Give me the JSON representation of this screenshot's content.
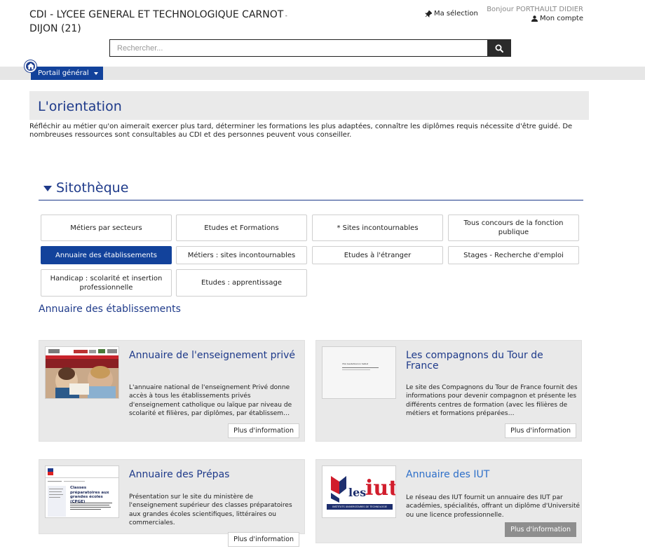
{
  "header": {
    "title_line1": "CDI - LYCEE GENERAL ET TECHNOLOGIQUE CARNOT",
    "title_sep": " -",
    "title_line2": "DIJON (21)",
    "selection_label": "Ma sélection",
    "greeting": "Bonjour PORTHAULT DIDIER",
    "account_label": "Mon compte"
  },
  "search": {
    "placeholder": "Rechercher..."
  },
  "nav": {
    "portal_label": "Portail général"
  },
  "page": {
    "title": "L'orientation",
    "intro": "Réfléchir au métier qu'on aimerait exercer plus tard, déterminer les formations les plus adaptées, connaître les diplômes requis nécessite d'être guidé. De nombreuses ressources sont consultables au CDI et des personnes peuvent vous conseiller."
  },
  "sitotheque": {
    "heading": "Sitothèque",
    "tiles": [
      "Métiers par secteurs",
      "Etudes et Formations",
      "* Sites incontournables",
      "Tous concours de la fonction publique",
      "Annuaire des établissements",
      "Métiers : sites incontournables",
      "Etudes à l'étranger",
      "Stages - Recherche d'emploi",
      "Handicap : scolarité et insertion professionnelle",
      "Etudes : apprentissage"
    ],
    "active_index": 4,
    "section_title": "Annuaire des établissements"
  },
  "cards": [
    {
      "title": "Annuaire de l'enseignement privé",
      "desc": "L'annuaire national de l'enseignement Privé donne accès à tous les établissements privés d'enseignement catholique ou laïque par niveau de scolarité et filières, par diplômes, par établissem…",
      "more": "Plus d'information"
    },
    {
      "title": "Les compagnons du Tour de France",
      "desc": "Le site des Compagnons du Tour de France fournit des informations pour devenir compagnon et présente les différents centres de formation (avec les filières de métiers et formations préparées…",
      "more": "Plus d'information",
      "thumb_text": "VSA Gestahlunion Selbst"
    },
    {
      "title": "Annuaire des Prépas",
      "desc": "Présentation sur le site du ministère de l'enseignement supérieur des classes préparatoires aux grandes écoles scientifiques, littéraires ou commerciales.",
      "more": "Plus d'information",
      "thumb_heading": "Classes préparatoires aux grandes écoles (CPGE)"
    },
    {
      "title": "Annuaire des IUT",
      "desc": "Le réseau des IUT fournit un annuaire des IUT par académies, spécialités, offrant un diplôme d'Université ou une licence professionnelle.",
      "more": "Plus d'information",
      "logo_les": "les",
      "logo_iut": "iut",
      "logo_caption": "INSTITUTS UNIVERSITAIRES DE TECHNOLOGIE"
    }
  ],
  "colors": {
    "primary": "#12429b",
    "heading": "#1e3a8a",
    "link_light": "#2d6fc9",
    "panel": "#e9e9e9"
  }
}
